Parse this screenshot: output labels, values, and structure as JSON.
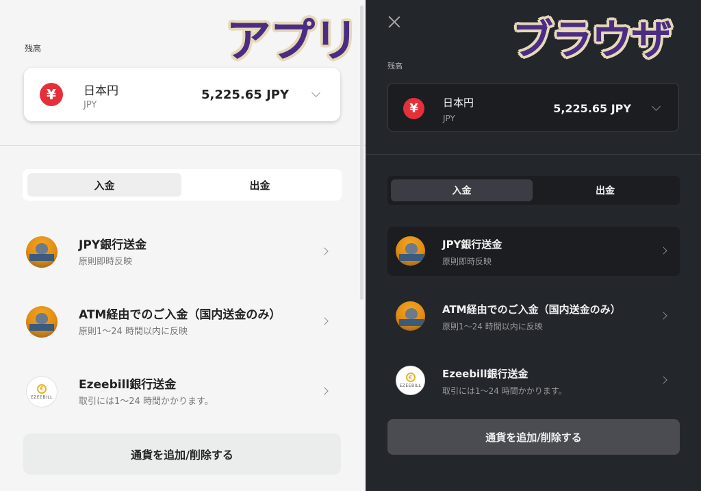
{
  "app_panel": {
    "overlay_label": "アプリ",
    "balance_label": "残高",
    "currency": {
      "symbol": "¥",
      "name": "日本円",
      "code": "JPY",
      "amount": "5,225.65 JPY"
    },
    "tabs": [
      {
        "label": "入金",
        "active": true
      },
      {
        "label": "出金",
        "active": false
      }
    ],
    "methods": [
      {
        "title": "JPY銀行送金",
        "subtitle": "原則即時反映",
        "icon": "bank-transfer-avatar"
      },
      {
        "title": "ATM経由でのご入金（国内送金のみ）",
        "subtitle": "原則1〜24 時間以内に反映",
        "icon": "atm-avatar"
      },
      {
        "title": "Ezeebill銀行送金",
        "subtitle": "取引には1〜24 時間かかります。",
        "icon": "ezeebill-logo",
        "logo_text": "EZEEBILL"
      }
    ],
    "add_button": "通貨を追加/削除する"
  },
  "browser_panel": {
    "overlay_label": "ブラウザ",
    "balance_label": "残高",
    "currency": {
      "symbol": "¥",
      "name": "日本円",
      "code": "JPY",
      "amount": "5,225.65 JPY"
    },
    "tabs": [
      {
        "label": "入金",
        "active": true
      },
      {
        "label": "出金",
        "active": false
      }
    ],
    "methods": [
      {
        "title": "JPY銀行送金",
        "subtitle": "原則即時反映",
        "icon": "bank-transfer-avatar",
        "selected": true
      },
      {
        "title": "ATM経由でのご入金（国内送金のみ）",
        "subtitle": "原則1〜24 時間以内に反映",
        "icon": "atm-avatar"
      },
      {
        "title": "Ezeebill銀行送金",
        "subtitle": "取引には1〜24 時間かかります。",
        "icon": "ezeebill-logo",
        "logo_text": "EZEEBILL"
      }
    ],
    "add_button": "通貨を追加/削除する"
  },
  "colors": {
    "yen_badge": "#e5303a",
    "overlay_text": "#4a2d83",
    "overlay_outline": "#e6d9b8",
    "light_bg": "#f4f5f4",
    "dark_bg": "#23262b"
  }
}
